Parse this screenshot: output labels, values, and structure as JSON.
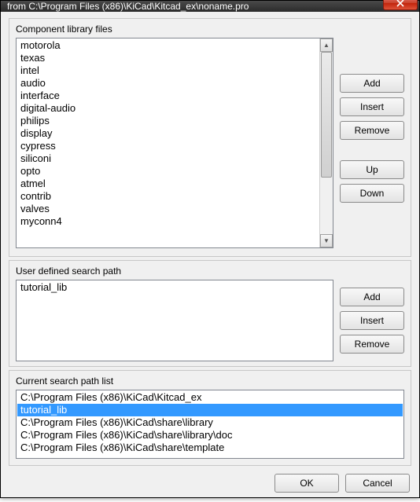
{
  "window": {
    "title": "from C:\\Program Files (x86)\\KiCad\\Kitcad_ex\\noname.pro"
  },
  "section_component": {
    "label": "Component library files",
    "items": [
      "motorola",
      "texas",
      "intel",
      "audio",
      "interface",
      "digital-audio",
      "philips",
      "display",
      "cypress",
      "siliconi",
      "opto",
      "atmel",
      "contrib",
      "valves",
      "myconn4"
    ],
    "buttons": {
      "add": "Add",
      "insert": "Insert",
      "remove": "Remove",
      "up": "Up",
      "down": "Down"
    }
  },
  "section_userpath": {
    "label": "User defined search path",
    "items": [
      "tutorial_lib"
    ],
    "buttons": {
      "add": "Add",
      "insert": "Insert",
      "remove": "Remove"
    }
  },
  "section_current": {
    "label": "Current search path list",
    "items": [
      "C:\\Program Files (x86)\\KiCad\\Kitcad_ex",
      "tutorial_lib",
      "C:\\Program Files (x86)\\KiCad\\share\\library",
      "C:\\Program Files (x86)\\KiCad\\share\\library\\doc",
      "C:\\Program Files (x86)\\KiCad\\share\\template"
    ],
    "selected_index": 1
  },
  "footer": {
    "ok": "OK",
    "cancel": "Cancel"
  }
}
